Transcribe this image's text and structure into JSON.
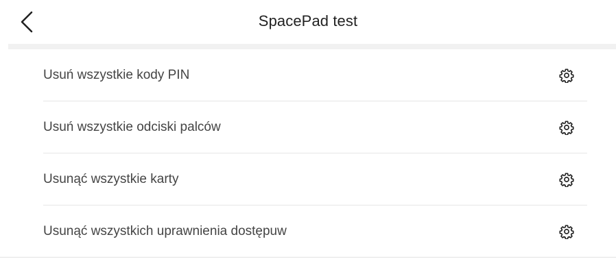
{
  "header": {
    "back_icon": "chevron-left-icon",
    "title": "SpacePad test"
  },
  "list": {
    "items": [
      {
        "label": "Usuń wszystkie kody PIN",
        "icon": "gear-icon"
      },
      {
        "label": "Usuń wszystkie odciski palców",
        "icon": "gear-icon"
      },
      {
        "label": "Usunąć wszystkie karty",
        "icon": "gear-icon"
      },
      {
        "label": "Usunąć wszystkich uprawnienia dostępuw",
        "icon": "gear-icon"
      }
    ]
  },
  "colors": {
    "background": "#ffffff",
    "separator": "#f1f1f1",
    "text": "#444444",
    "icon": "#222222"
  }
}
